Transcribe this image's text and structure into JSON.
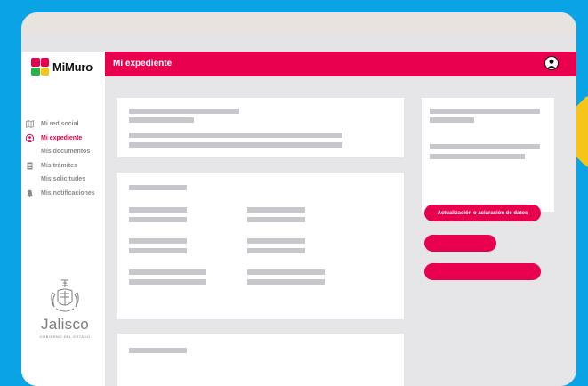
{
  "app": {
    "logo_text": "MiMuro",
    "header_title": "Mi expediente"
  },
  "nav": [
    {
      "label": "Mi red social",
      "icon": "map-icon"
    },
    {
      "label": "Mi expediente",
      "icon": "user-circle-icon",
      "active": true
    },
    {
      "label": "Mis documentos"
    },
    {
      "label": "Mis trámites",
      "icon": "document-icon"
    },
    {
      "label": "Mis solicitudes"
    },
    {
      "label": "Mis notificaciones",
      "icon": "bell-icon"
    }
  ],
  "branding": {
    "name": "Jalisco",
    "subtitle": "GOBIERNO DEL ESTADO"
  },
  "actions": {
    "update_label": "Actualización o aclaración de datos"
  },
  "colors": {
    "accent": "#e8004f",
    "background": "#0aa3e3",
    "highlight": "#f5c518"
  }
}
